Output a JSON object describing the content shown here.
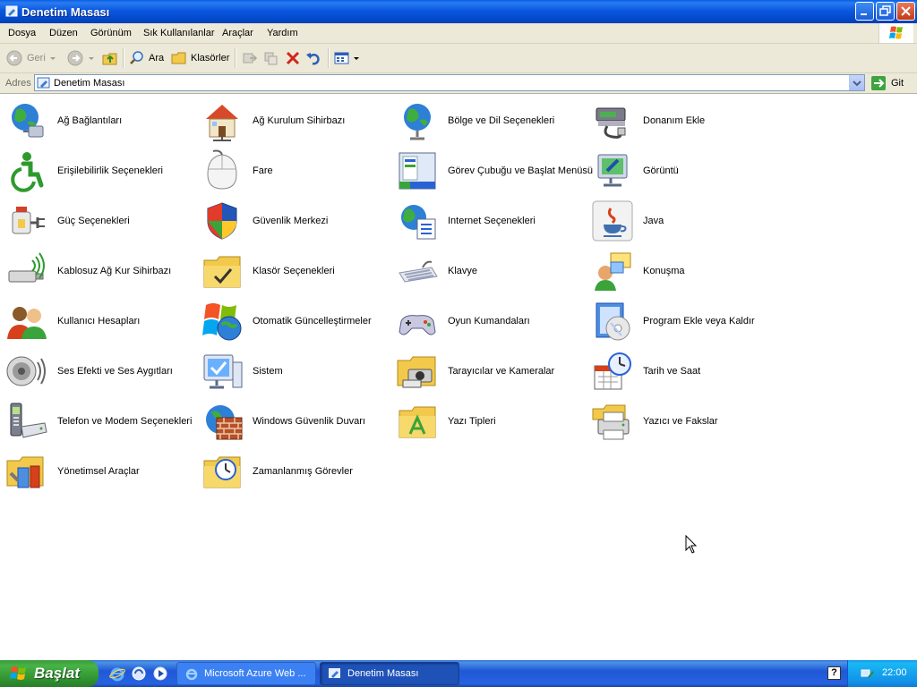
{
  "window": {
    "title": "Denetim Masası",
    "controls": [
      "minimize",
      "maximize",
      "close"
    ]
  },
  "menu": [
    "Dosya",
    "Düzen",
    "Görünüm",
    "Sık Kullanılanlar",
    "Araçlar",
    "Yardım"
  ],
  "toolbar": {
    "back": "Geri",
    "search": "Ara",
    "folders": "Klasörler"
  },
  "address": {
    "label": "Adres",
    "value": "Denetim Masası",
    "go": "Git"
  },
  "items": [
    {
      "label": "Ağ Bağlantıları",
      "icon": "network-connections-icon"
    },
    {
      "label": "Ağ Kurulum Sihirbazı",
      "icon": "network-setup-wizard-icon"
    },
    {
      "label": "Bölge ve Dil Seçenekleri",
      "icon": "regional-language-icon"
    },
    {
      "label": "Donanım Ekle",
      "icon": "add-hardware-icon"
    },
    {
      "label": "Erişilebilirlik Seçenekleri",
      "icon": "accessibility-icon"
    },
    {
      "label": "Fare",
      "icon": "mouse-icon"
    },
    {
      "label": "Görev Çubuğu ve Başlat Menüsü",
      "icon": "taskbar-start-menu-icon"
    },
    {
      "label": "Görüntü",
      "icon": "display-icon"
    },
    {
      "label": "Güç Seçenekleri",
      "icon": "power-options-icon"
    },
    {
      "label": "Güvenlik Merkezi",
      "icon": "security-center-icon"
    },
    {
      "label": "Internet Seçenekleri",
      "icon": "internet-options-icon"
    },
    {
      "label": "Java",
      "icon": "java-icon"
    },
    {
      "label": "Kablosuz Ağ Kur Sihirbazı",
      "icon": "wireless-network-wizard-icon"
    },
    {
      "label": "Klasör Seçenekleri",
      "icon": "folder-options-icon"
    },
    {
      "label": "Klavye",
      "icon": "keyboard-icon"
    },
    {
      "label": "Konuşma",
      "icon": "speech-icon"
    },
    {
      "label": "Kullanıcı Hesapları",
      "icon": "user-accounts-icon"
    },
    {
      "label": "Otomatik Güncelleştirmeler",
      "icon": "automatic-updates-icon"
    },
    {
      "label": "Oyun Kumandaları",
      "icon": "game-controllers-icon"
    },
    {
      "label": "Program Ekle veya Kaldır",
      "icon": "add-remove-programs-icon"
    },
    {
      "label": "Ses Efekti ve Ses Aygıtları",
      "icon": "sounds-audio-icon"
    },
    {
      "label": "Sistem",
      "icon": "system-icon"
    },
    {
      "label": "Tarayıcılar ve Kameralar",
      "icon": "scanners-cameras-icon"
    },
    {
      "label": "Tarih ve Saat",
      "icon": "date-time-icon"
    },
    {
      "label": "Telefon ve Modem Seçenekleri",
      "icon": "phone-modem-icon"
    },
    {
      "label": "Windows Güvenlik Duvarı",
      "icon": "windows-firewall-icon"
    },
    {
      "label": "Yazı Tipleri",
      "icon": "fonts-icon"
    },
    {
      "label": "Yazıcı ve Fakslar",
      "icon": "printers-faxes-icon"
    },
    {
      "label": "Yönetimsel Araçlar",
      "icon": "administrative-tools-icon"
    },
    {
      "label": "Zamanlanmış Görevler",
      "icon": "scheduled-tasks-icon"
    }
  ],
  "taskbar": {
    "start": "Başlat",
    "tasks": [
      "Microsoft Azure Web ...",
      "Denetim Masası"
    ],
    "clock": "22:00"
  }
}
